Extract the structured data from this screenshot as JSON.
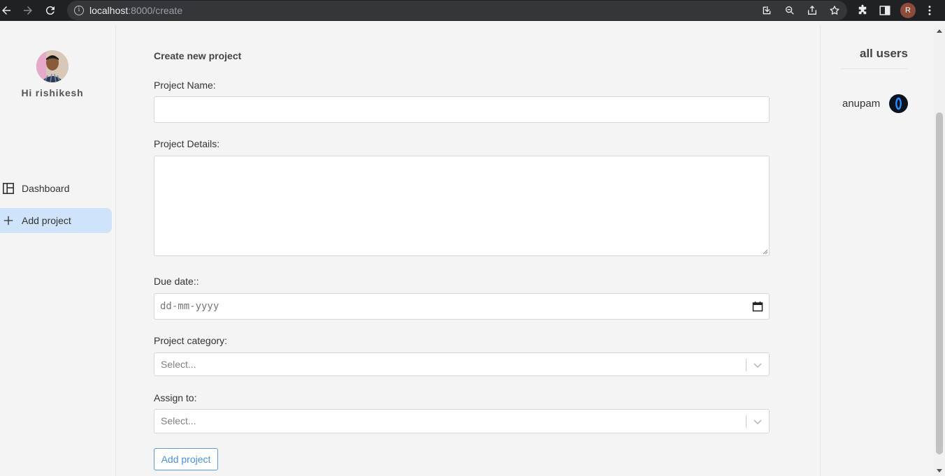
{
  "browser": {
    "url_host": "localhost",
    "url_rest": ":8000/create",
    "profile_initial": "R"
  },
  "sidebar": {
    "greeting": "Hi rishikesh",
    "items": [
      {
        "label": "Dashboard",
        "icon": "dashboard-icon",
        "active": false
      },
      {
        "label": "Add project",
        "icon": "plus-icon",
        "active": true
      }
    ]
  },
  "form": {
    "title": "Create new project",
    "project_name_label": "Project Name:",
    "project_name_value": "",
    "project_details_label": "Project Details:",
    "project_details_value": "",
    "due_date_label": "Due date::",
    "due_date_placeholder": "dd-mm-yyyy",
    "category_label": "Project category:",
    "category_placeholder": "Select...",
    "assign_label": "Assign to:",
    "assign_placeholder": "Select...",
    "submit_label": "Add project"
  },
  "users_panel": {
    "title": "all users",
    "users": [
      {
        "name": "anupam"
      }
    ]
  },
  "colors": {
    "accent": "#4a90d9",
    "active_nav": "#cfe4fb",
    "chrome_bg": "#202124"
  }
}
